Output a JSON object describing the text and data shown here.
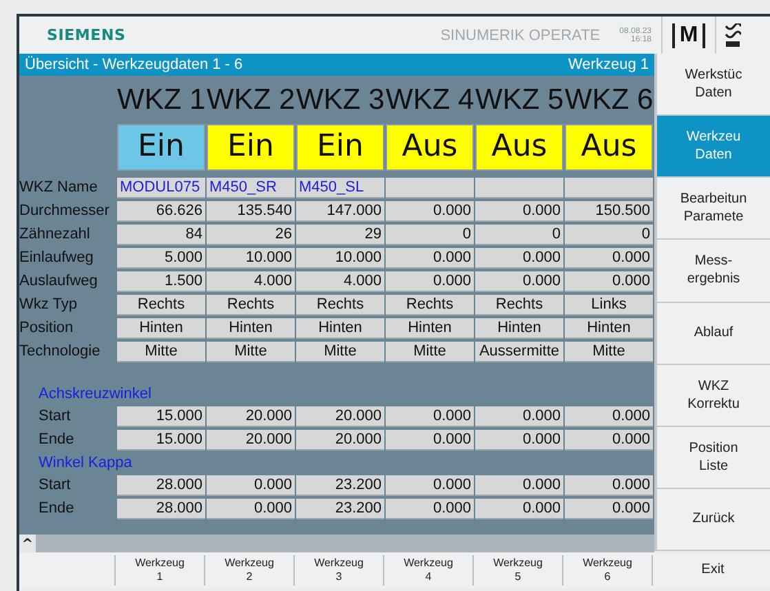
{
  "header": {
    "brand": "SIEMENS",
    "product": "SINUMERIK OPERATE",
    "date": "08.08.23",
    "time": "16:18",
    "mode_key": "M"
  },
  "title_bar": {
    "title": "Übersicht - Werkzeugdaten 1 - 6",
    "tool": "Werkzeug 1"
  },
  "columns": [
    {
      "heading": "WKZ 1",
      "status": "Ein",
      "selected": true
    },
    {
      "heading": "WKZ 2",
      "status": "Ein",
      "selected": false
    },
    {
      "heading": "WKZ 3",
      "status": "Ein",
      "selected": false
    },
    {
      "heading": "WKZ 4",
      "status": "Aus",
      "selected": false
    },
    {
      "heading": "WKZ 5",
      "status": "Aus",
      "selected": false
    },
    {
      "heading": "WKZ 6",
      "status": "Aus",
      "selected": false
    }
  ],
  "rows": [
    {
      "label": "WKZ Name",
      "kind": "name",
      "cells": [
        "MODUL075",
        "M450_SR",
        "M450_SL",
        "",
        "",
        ""
      ]
    },
    {
      "label": "Durchmesser",
      "kind": "number",
      "cells": [
        "66.626",
        "135.540",
        "147.000",
        "0.000",
        "0.000",
        "150.500"
      ]
    },
    {
      "label": "Zähnezahl",
      "kind": "number",
      "cells": [
        "84",
        "26",
        "29",
        "0",
        "0",
        "0"
      ]
    },
    {
      "label": "Einlaufweg",
      "kind": "number",
      "cells": [
        "5.000",
        "10.000",
        "10.000",
        "0.000",
        "0.000",
        "0.000"
      ]
    },
    {
      "label": "Auslaufweg",
      "kind": "number",
      "cells": [
        "1.500",
        "4.000",
        "4.000",
        "0.000",
        "0.000",
        "0.000"
      ]
    },
    {
      "label": "Wkz Typ",
      "kind": "text",
      "cells": [
        "Rechts",
        "Rechts",
        "Rechts",
        "Rechts",
        "Rechts",
        "Links"
      ]
    },
    {
      "label": "Position",
      "kind": "text",
      "cells": [
        "Hinten",
        "Hinten",
        "Hinten",
        "Hinten",
        "Hinten",
        "Hinten"
      ]
    },
    {
      "label": "Technologie",
      "kind": "text",
      "cells": [
        "Mitte",
        "Mitte",
        "Mitte",
        "Mitte",
        "Aussermitte",
        "Mitte"
      ]
    }
  ],
  "sections": [
    {
      "title": "Achskreuzwinkel",
      "rows": [
        {
          "label": "Start",
          "kind": "number",
          "cells": [
            "15.000",
            "20.000",
            "20.000",
            "0.000",
            "0.000",
            "0.000"
          ]
        },
        {
          "label": "Ende",
          "kind": "number",
          "cells": [
            "15.000",
            "20.000",
            "20.000",
            "0.000",
            "0.000",
            "0.000"
          ]
        }
      ]
    },
    {
      "title": "Winkel Kappa",
      "rows": [
        {
          "label": "Start",
          "kind": "number",
          "cells": [
            "28.000",
            "0.000",
            "23.200",
            "0.000",
            "0.000",
            "0.000"
          ]
        },
        {
          "label": "Ende",
          "kind": "number",
          "cells": [
            "28.000",
            "0.000",
            "23.200",
            "0.000",
            "0.000",
            "0.000"
          ]
        }
      ]
    }
  ],
  "scroll_up": "^",
  "sidebar": [
    {
      "lines": [
        "Werkstüc",
        "Daten"
      ],
      "selected": false
    },
    {
      "lines": [
        "Werkzeu",
        "Daten"
      ],
      "selected": true
    },
    {
      "lines": [
        "Bearbeitun",
        "Paramete"
      ],
      "selected": false
    },
    {
      "lines": [
        "Mess-",
        "ergebnis"
      ],
      "selected": false
    },
    {
      "lines": [
        "Ablauf"
      ],
      "selected": false
    },
    {
      "lines": [
        "WKZ",
        "Korrektu"
      ],
      "selected": false
    },
    {
      "lines": [
        "Position",
        "Liste"
      ],
      "selected": false
    },
    {
      "lines": [
        "Zurück"
      ],
      "selected": false
    }
  ],
  "softkeys": [
    {
      "lines": [
        "Werkzeug",
        "1"
      ]
    },
    {
      "lines": [
        "Werkzeug",
        "2"
      ]
    },
    {
      "lines": [
        "Werkzeug",
        "3"
      ]
    },
    {
      "lines": [
        "Werkzeug",
        "4"
      ]
    },
    {
      "lines": [
        "Werkzeug",
        "5"
      ]
    },
    {
      "lines": [
        "Werkzeug",
        "6"
      ]
    },
    {
      "lines": [
        "Exit"
      ]
    }
  ]
}
